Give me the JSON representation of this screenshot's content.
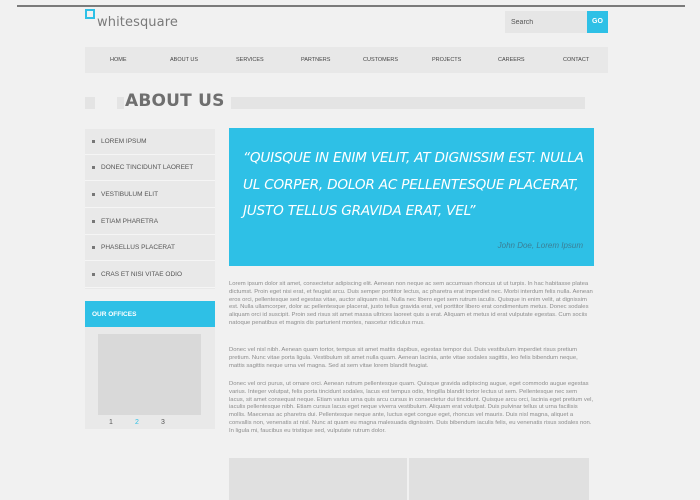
{
  "header": {
    "logo_text": "whitesquare",
    "search_placeholder": "Search",
    "go_label": "GO"
  },
  "nav": [
    "HOME",
    "ABOUT US",
    "SERVICES",
    "PARTNERS",
    "CUSTOMERS",
    "PROJECTS",
    "CAREERS",
    "CONTACT"
  ],
  "page_title": "ABOUT US",
  "sidebar": {
    "items": [
      "LOREM IPSUM",
      "DONEC TINCIDUNT LAOREET",
      "VESTIBULUM ELIT",
      "ETIAM PHARETRA",
      "PHASELLUS PLACERAT",
      "CRAS ET NISI VITAE ODIO"
    ],
    "offices_heading": "OUR OFFICES",
    "pagination": [
      "1",
      "2",
      "3"
    ],
    "pagination_active": "2"
  },
  "quote": {
    "text": "“QUISQUE IN ENIM VELIT, AT DIGNISSIM EST. NULLA UL CORPER, DOLOR AC PELLENTESQUE PLACERAT, JUSTO TELLUS GRAVIDA ERAT, VEL”",
    "author": "John Doe, Lorem Ipsum"
  },
  "paragraphs": [
    "Lorem ipsum dolor sit amet, consectetur adipiscing elit. Aenean non neque ac sem accumsan rhoncus ut ut turpis. In hac habitasse platea dictumst. Proin eget nisi erat, et feugiat arcu. Duis semper porttitor lectus, ac pharetra erat imperdiet nec. Morbi interdum felis nulla. Aenean eros orci, pellentesque sed egestas vitae, auctor aliquam nisi. Nulla nec libero eget sem rutrum iaculis. Quisque in enim velit, at dignissim est. Nulla ullamcorper, dolor ac pellentesque placerat, justo tellus gravida erat, vel porttitor libero erat condimentum metus. Donec sodales aliquam orci id suscipit. Proin sed risus sit amet massa ultrices laoreet quis a erat. Aliquam et metus id erat vulputate egestas. Cum sociis natoque penatibus et magnis dis parturient montes, nascetur ridiculus mus.",
    "Donec vel nisl nibh. Aenean quam tortor, tempus sit amet mattis dapibus, egestas tempor dui. Duis vestibulum imperdiet risus pretium pretium. Nunc vitae porta ligula. Vestibulum sit amet nulla quam. Aenean lacinia, ante vitae sodales sagittis, leo felis bibendum neque, mattis sagittis neque urna vel magna. Sed at sem vitae lorem blandit feugiat.",
    "Donec vel orci purus, ut ornare orci. Aenean rutrum pellentesque quam. Quisque gravida adipiscing augue, eget commodo augue egestas varius. Integer volutpat, felis porta tincidunt sodales, lacus est tempus odio, fringilla blandit tortor lectus ut sem. Pellentesque nec sem lacus, sit amet consequat neque. Etiam varius urna quis arcu cursus in consectetur dui tincidunt. Quisque arcu orci, lacinia eget pretium vel, iaculis pellentesque nibh. Etiam cursus lacus eget neque viverra vestibulum. Aliquam erat volutpat. Duis pulvinar tellus ut urna facilisis mollis. Maecenas ac pharetra dui. Pellentesque neque ante, luctus eget congue eget, rhoncus vel mauris. Duis nisl magna, aliquet a convallis non, venenatis at nisl. Nunc at quam eu magna malesuada dignissim. Duis bibendum iaculis felis, eu venenatis risus sodales non. In ligula mi, faucibus eu tristique sed, vulputate rutrum dolor."
  ],
  "colors": {
    "accent": "#2ec0e6",
    "background": "#f1f1f1",
    "panel": "#e9e9e9"
  }
}
